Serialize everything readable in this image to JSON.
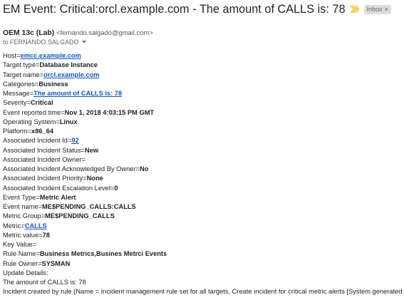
{
  "header": {
    "subject": "EM Event: Critical:orcl.example.com - The amount of CALLS is: 78",
    "importance_icon": "importance-marker-icon",
    "label": "Inbox",
    "label_remove": "×"
  },
  "sender": {
    "name": "OEM 13c (Lab)",
    "email": "<fernando.salgado@gmail.com>",
    "to": "to FERNANDO.SALGADO"
  },
  "message": {
    "host_label": "Host=",
    "host_value": "emcc.example.com",
    "target_type_label": "Target type=",
    "target_type_value": "Database Instance",
    "target_name_label": "Target name=",
    "target_name_value": "orcl.example.com",
    "categories_label": "Categories=",
    "categories_value": "Business",
    "message_label": "Message=",
    "message_value": "The amount of CALLS is: 78",
    "severity_label": "Severity=",
    "severity_value": "Critical",
    "reported_label": "Event reported time=",
    "reported_value": "Nov 1, 2018 4:03:15 PM GMT",
    "os_label": "Operating System=",
    "os_value": "Linux",
    "platform_label": "Platform=",
    "platform_value": "x86_64",
    "incident_id_label": "Associated Incident Id=",
    "incident_id_value": "92",
    "incident_status_label": "Associated Incident Status=",
    "incident_status_value": "New",
    "incident_owner_label": "Associated Incident Owner=",
    "incident_ack_label": "Associated Incident Acknowledged By Owner=",
    "incident_ack_value": "No",
    "incident_priority_label": "Associated Incident Priority=",
    "incident_priority_value": "None",
    "incident_escalation_label": "Associated Incident Escalation Level=",
    "incident_escalation_value": "0",
    "event_type_label": "Event Type=",
    "event_type_value": "Metric Alert",
    "event_name_label": "Event name=",
    "event_name_value": "ME$PENDING_CALLS:CALLS",
    "metric_group_label": "Metric Group=",
    "metric_group_value": "ME$PENDING_CALLS",
    "metric_label": "Metric=",
    "metric_value": "CALLS",
    "metric_val_label": "Metric value=",
    "metric_val_value": "78",
    "key_value_label": "Key Value=",
    "rule_name_label": "Rule Name=",
    "rule_name_value": "Business Metrics,Busines Metrci Events",
    "rule_owner_label": "Rule Owner=",
    "rule_owner_value": "SYSMAN",
    "update_details": "Update Details:",
    "update_text": "The amount of CALLS is: 78",
    "incident_created": "Incident created by rule (Name = Incident management rule set for all targets, Create incident for critical metric alerts [System generated rule])."
  },
  "colors": {
    "link": "#1155cc",
    "importance": "#f4d35e",
    "chip_bg": "#dddddd"
  }
}
